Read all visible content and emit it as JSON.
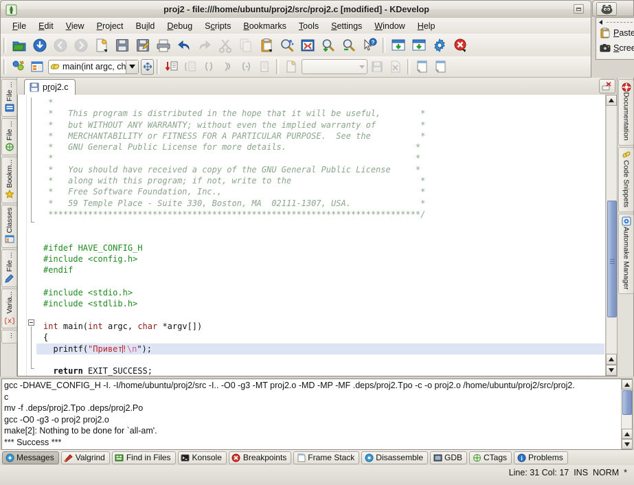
{
  "window": {
    "title": "proj2 - file:///home/ubuntu/proj2/src/proj2.c [modified] - KDevelop",
    "app_icon": "kdevelop-icon",
    "minimize_label": "_"
  },
  "menubar": {
    "items": [
      {
        "label": "File",
        "accel": "F"
      },
      {
        "label": "Edit",
        "accel": "E"
      },
      {
        "label": "View",
        "accel": "V"
      },
      {
        "label": "Project",
        "accel": "P"
      },
      {
        "label": "Build",
        "accel": "i"
      },
      {
        "label": "Debug",
        "accel": "D"
      },
      {
        "label": "Scripts",
        "accel": "c"
      },
      {
        "label": "Bookmarks",
        "accel": "B"
      },
      {
        "label": "Tools",
        "accel": "T"
      },
      {
        "label": "Settings",
        "accel": "S"
      },
      {
        "label": "Window",
        "accel": "W"
      },
      {
        "label": "Help",
        "accel": "H"
      }
    ]
  },
  "toolbar_main": {
    "icons": [
      "open-project-icon",
      "open-file-icon",
      "back-icon",
      "forward-icon",
      "new-file-icon",
      "save-icon",
      "save-as-icon",
      "print-icon",
      "undo-icon",
      "redo-icon",
      "cut-icon",
      "copy-icon",
      "paste-icon",
      "find-icon",
      "replace-icon",
      "zoom-in-icon",
      "zoom-out-icon",
      "whats-this-icon",
      "build-project-icon",
      "build-file-icon",
      "configure-icon",
      "stop-icon"
    ]
  },
  "toolbar_browse": {
    "class_icon": "classes-icon",
    "namespace_icon": "namespace-icon",
    "method_combo": {
      "value": "main(int argc, ch",
      "icon": "function-icon"
    },
    "file_combo": {
      "value": "",
      "placeholder": ""
    },
    "icons": [
      "goto-declaration-icon",
      "switch-header-icon",
      "prev-function-icon",
      "next-function-icon",
      "prev-block-icon",
      "list-icon",
      "new-class-icon",
      "save-small-icon",
      "discard-icon",
      "new-doc-1-icon",
      "new-doc-2-icon"
    ]
  },
  "left_dock_tabs": [
    {
      "label": "File ...",
      "icon": "file-tree-icon"
    },
    {
      "label": "File ...",
      "icon": "file-groups-icon"
    },
    {
      "label": "Bookm...",
      "icon": "bookmark-star-icon"
    },
    {
      "label": "Classes",
      "icon": "classes-view-icon"
    },
    {
      "label": "File ...",
      "icon": "file-selector-icon"
    },
    {
      "label": "Varia...",
      "icon": "variables-icon"
    },
    {
      "label": "...",
      "icon": "more-icon"
    }
  ],
  "right_dock_tabs": [
    {
      "label": "Documentation",
      "icon": "documentation-icon"
    },
    {
      "label": "Code Snippets",
      "icon": "code-snippets-icon"
    },
    {
      "label": "Automake Manager",
      "icon": "automake-icon"
    }
  ],
  "editor": {
    "tab": {
      "label": "proj2.c",
      "accel": "r",
      "icon": "save-file-icon",
      "modified": true
    },
    "tabbar_close_icon": "close-tab-icon",
    "lines": [
      {
        "t": "comment",
        "text": " *"
      },
      {
        "t": "comment",
        "text": " *   This program is distributed in the hope that it will be useful,        *"
      },
      {
        "t": "comment",
        "text": " *   but WITHOUT ANY WARRANTY; without even the implied warranty of         *"
      },
      {
        "t": "comment",
        "text": " *   MERCHANTABILITY or FITNESS FOR A PARTICULAR PURPOSE.  See the          *"
      },
      {
        "t": "comment",
        "text": " *   GNU General Public License for more details.                          *"
      },
      {
        "t": "comment",
        "text": " *                                                                         *"
      },
      {
        "t": "comment",
        "text": " *   You should have received a copy of the GNU General Public License     *"
      },
      {
        "t": "comment",
        "text": " *   along with this program; if not, write to the                          *"
      },
      {
        "t": "comment",
        "text": " *   Free Software Foundation, Inc.,                                        *"
      },
      {
        "t": "comment",
        "text": " *   59 Temple Place - Suite 330, Boston, MA  02111-1307, USA.              *"
      },
      {
        "t": "comment",
        "text": " ***************************************************************************/"
      },
      {
        "t": "blank",
        "text": ""
      },
      {
        "t": "blank",
        "text": ""
      },
      {
        "t": "preproc",
        "text": "#ifdef HAVE_CONFIG_H"
      },
      {
        "t": "preproc",
        "text": "#include <config.h>"
      },
      {
        "t": "preproc",
        "text": "#endif"
      },
      {
        "t": "blank",
        "text": ""
      },
      {
        "t": "preproc",
        "text": "#include <stdio.h>"
      },
      {
        "t": "preproc",
        "text": "#include <stdlib.h>"
      },
      {
        "t": "blank",
        "text": ""
      },
      {
        "t": "mainsig",
        "text": "int main(int argc, char *argv[])"
      },
      {
        "t": "brace",
        "text": "{"
      },
      {
        "t": "printf",
        "text": "  printf(\"Привет!\\n\");",
        "highlighted": true
      },
      {
        "t": "blank",
        "text": ""
      },
      {
        "t": "return",
        "text": "  return EXIT_SUCCESS;"
      },
      {
        "t": "brace",
        "text": "}"
      }
    ],
    "printf_parts": {
      "indent": "  ",
      "func": "printf",
      "open": "(",
      "quote": "\"",
      "string": "Привет",
      "bang": "!",
      "escape": "\\n",
      "close": "\");"
    },
    "mainsig_parts": {
      "int1": "int",
      "sp1": " main(",
      "int2": "int",
      "sp2": " argc, ",
      "char1": "char",
      "sp3": " *argv[])"
    },
    "return_parts": {
      "indent": "  ",
      "kw": "return",
      "rest": " EXIT_SUCCESS;"
    }
  },
  "output": {
    "lines": [
      "gcc -DHAVE_CONFIG_H -I. -I/home/ubuntu/proj2/src -I.. -O0 -g3 -MT proj2.o -MD -MP -MF .deps/proj2.Tpo -c -o proj2.o /home/ubuntu/proj2/src/proj2.",
      "c",
      "mv -f .deps/proj2.Tpo .deps/proj2.Po",
      "gcc -O0 -g3 -o proj2 proj2.o",
      "make[2]: Nothing to be done for `all-am'.",
      "*** Success ***"
    ]
  },
  "bottom_tabs": [
    {
      "label": "Messages",
      "icon": "messages-icon",
      "active": true
    },
    {
      "label": "Valgrind",
      "icon": "valgrind-icon",
      "active": false
    },
    {
      "label": "Find in Files",
      "icon": "find-in-files-icon",
      "active": false
    },
    {
      "label": "Konsole",
      "icon": "konsole-icon",
      "active": false
    },
    {
      "label": "Breakpoints",
      "icon": "breakpoints-icon",
      "active": false
    },
    {
      "label": "Frame Stack",
      "icon": "frame-stack-icon",
      "active": false
    },
    {
      "label": "Disassemble",
      "icon": "disassemble-icon",
      "active": false
    },
    {
      "label": "GDB",
      "icon": "gdb-icon",
      "active": false
    },
    {
      "label": "CTags",
      "icon": "ctags-icon",
      "active": false
    },
    {
      "label": "Problems",
      "icon": "problems-icon",
      "active": false
    }
  ],
  "statusbar": {
    "text": "Line: 31 Col: 17  INS  NORM  *"
  },
  "gimp": {
    "titlebar_icon": "gimp-wilber-icon",
    "menu_items": [
      {
        "label": "Paste",
        "accel": "P",
        "icon": "paste-icon"
      },
      {
        "label": "Scree",
        "accel": "S",
        "icon": "screenshot-camera-icon"
      }
    ]
  },
  "colors": {
    "comment": "#8aa58a",
    "preproc": "#1f8a1f",
    "keyword": "#8b1a1a",
    "string": "#c0222b",
    "escape": "#cf5a9e",
    "highlight_line": "#dde4f4",
    "scrollbar_thumb": "#8aa0cc"
  }
}
